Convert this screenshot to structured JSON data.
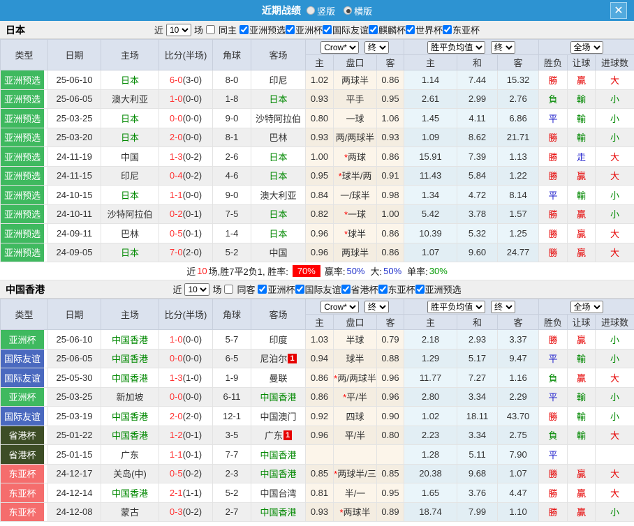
{
  "titlebar": {
    "title": "近期战绩",
    "vertical_label": "竖版",
    "horizontal_label": "横版",
    "close_glyph": "✕"
  },
  "columns": {
    "type": "类型",
    "date": "日期",
    "home": "主场",
    "score": "比分(半场)",
    "corner": "角球",
    "away": "客场",
    "h": "主",
    "hcp": "盘口",
    "a": "客",
    "avg_h": "主",
    "avg_d": "和",
    "avg_a": "客",
    "wdl": "胜负",
    "hcp_r": "让球",
    "goals": "进球数"
  },
  "sections": [
    {
      "team": "日本",
      "filter": {
        "near_label": "近",
        "near_value": "10",
        "games_label": "场",
        "same_label": "同主",
        "leagues": [
          "亚洲预选",
          "亚洲杯",
          "国际友谊",
          "麒麟杯",
          "世界杯",
          "东亚杯"
        ]
      },
      "controls": {
        "provider": "Crow*",
        "final1": "终",
        "avg": "胜平负均值",
        "final2": "终",
        "scope": "全场"
      },
      "rows": [
        {
          "type": "亚洲预选",
          "tc": "green",
          "date": "25-06-10",
          "home": "日本",
          "hg": true,
          "score": "6-0",
          "half": "(3-0)",
          "corner": "8-0",
          "away": "印尼",
          "ag": false,
          "ab": "",
          "oh": "1.02",
          "hcp": "两球半",
          "oa": "0.86",
          "ah": "1.14",
          "ad": "7.44",
          "aa": "15.32",
          "r1": "勝",
          "r2": "贏",
          "r3": "大"
        },
        {
          "type": "亚洲预选",
          "tc": "green",
          "date": "25-06-05",
          "home": "澳大利亚",
          "hg": false,
          "score": "1-0",
          "half": "(0-0)",
          "corner": "1-8",
          "away": "日本",
          "ag": true,
          "ab": "",
          "oh": "0.93",
          "hcp": "平手",
          "oa": "0.95",
          "ah": "2.61",
          "ad": "2.99",
          "aa": "2.76",
          "r1": "負",
          "r2": "輸",
          "r3": "小"
        },
        {
          "type": "亚洲预选",
          "tc": "green",
          "date": "25-03-25",
          "home": "日本",
          "hg": true,
          "score": "0-0",
          "half": "(0-0)",
          "corner": "9-0",
          "away": "沙特阿拉伯",
          "ag": false,
          "ab": "",
          "oh": "0.80",
          "hcp": "一球",
          "oa": "1.06",
          "ah": "1.45",
          "ad": "4.11",
          "aa": "6.86",
          "r1": "平",
          "r2": "輸",
          "r3": "小"
        },
        {
          "type": "亚洲预选",
          "tc": "green",
          "date": "25-03-20",
          "home": "日本",
          "hg": true,
          "score": "2-0",
          "half": "(0-0)",
          "corner": "8-1",
          "away": "巴林",
          "ag": false,
          "ab": "",
          "oh": "0.93",
          "hcp": "两/两球半",
          "oa": "0.93",
          "ah": "1.09",
          "ad": "8.62",
          "aa": "21.71",
          "r1": "勝",
          "r2": "輸",
          "r3": "小"
        },
        {
          "type": "亚洲预选",
          "tc": "green",
          "date": "24-11-19",
          "home": "中国",
          "hg": false,
          "score": "1-3",
          "half": "(0-2)",
          "corner": "2-6",
          "away": "日本",
          "ag": true,
          "ab": "",
          "oh": "1.00",
          "hcp": "*两球",
          "oa": "0.86",
          "ah": "15.91",
          "ad": "7.39",
          "aa": "1.13",
          "r1": "勝",
          "r2": "走",
          "r3": "大"
        },
        {
          "type": "亚洲预选",
          "tc": "green",
          "date": "24-11-15",
          "home": "印尼",
          "hg": false,
          "score": "0-4",
          "half": "(0-2)",
          "corner": "4-6",
          "away": "日本",
          "ag": true,
          "ab": "",
          "oh": "0.95",
          "hcp": "*球半/两",
          "oa": "0.91",
          "ah": "11.43",
          "ad": "5.84",
          "aa": "1.22",
          "r1": "勝",
          "r2": "贏",
          "r3": "大"
        },
        {
          "type": "亚洲预选",
          "tc": "green",
          "date": "24-10-15",
          "home": "日本",
          "hg": true,
          "score": "1-1",
          "half": "(0-0)",
          "corner": "9-0",
          "away": "澳大利亚",
          "ag": false,
          "ab": "",
          "oh": "0.84",
          "hcp": "一/球半",
          "oa": "0.98",
          "ah": "1.34",
          "ad": "4.72",
          "aa": "8.14",
          "r1": "平",
          "r2": "輸",
          "r3": "小"
        },
        {
          "type": "亚洲预选",
          "tc": "green",
          "date": "24-10-11",
          "home": "沙特阿拉伯",
          "hg": false,
          "score": "0-2",
          "half": "(0-1)",
          "corner": "7-5",
          "away": "日本",
          "ag": true,
          "ab": "",
          "oh": "0.82",
          "hcp": "*一球",
          "oa": "1.00",
          "ah": "5.42",
          "ad": "3.78",
          "aa": "1.57",
          "r1": "勝",
          "r2": "贏",
          "r3": "小"
        },
        {
          "type": "亚洲预选",
          "tc": "green",
          "date": "24-09-11",
          "home": "巴林",
          "hg": false,
          "score": "0-5",
          "half": "(0-1)",
          "corner": "1-4",
          "away": "日本",
          "ag": true,
          "ab": "",
          "oh": "0.96",
          "hcp": "*球半",
          "oa": "0.86",
          "ah": "10.39",
          "ad": "5.32",
          "aa": "1.25",
          "r1": "勝",
          "r2": "贏",
          "r3": "大"
        },
        {
          "type": "亚洲预选",
          "tc": "green",
          "date": "24-09-05",
          "home": "日本",
          "hg": true,
          "score": "7-0",
          "half": "(2-0)",
          "corner": "5-2",
          "away": "中国",
          "ag": false,
          "ab": "",
          "oh": "0.96",
          "hcp": "两球半",
          "oa": "0.86",
          "ah": "1.07",
          "ad": "9.60",
          "aa": "24.77",
          "r1": "勝",
          "r2": "贏",
          "r3": "大"
        }
      ],
      "summary": {
        "part1": "近",
        "count": "10",
        "part2": "场,胜7平2负1, 胜率:",
        "badge": "70%",
        "win_label": "赢率:",
        "win_value": "50%",
        "big_label": "大:",
        "big_value": "50%",
        "single_label": "单率:",
        "single_value": "30%"
      }
    },
    {
      "team": "中国香港",
      "filter": {
        "near_label": "近",
        "near_value": "10",
        "games_label": "场",
        "same_label": "同客",
        "leagues": [
          "亚洲杯",
          "国际友谊",
          "省港杯",
          "东亚杯",
          "亚洲预选"
        ]
      },
      "controls": {
        "provider": "Crow*",
        "final1": "终",
        "avg": "胜平负均值",
        "final2": "终",
        "scope": "全场"
      },
      "rows": [
        {
          "type": "亚洲杯",
          "tc": "green",
          "date": "25-06-10",
          "home": "中国香港",
          "hg": true,
          "score": "1-0",
          "half": "(0-0)",
          "corner": "5-7",
          "away": "印度",
          "ag": false,
          "ab": "",
          "oh": "1.03",
          "hcp": "半球",
          "oa": "0.79",
          "ah": "2.18",
          "ad": "2.93",
          "aa": "3.37",
          "r1": "勝",
          "r2": "贏",
          "r3": "小"
        },
        {
          "type": "国际友谊",
          "tc": "blue",
          "date": "25-06-05",
          "home": "中国香港",
          "hg": true,
          "score": "0-0",
          "half": "(0-0)",
          "corner": "6-5",
          "away": "尼泊尔",
          "ag": false,
          "ab": "1",
          "oh": "0.94",
          "hcp": "球半",
          "oa": "0.88",
          "ah": "1.29",
          "ad": "5.17",
          "aa": "9.47",
          "r1": "平",
          "r2": "輸",
          "r3": "小"
        },
        {
          "type": "国际友谊",
          "tc": "blue",
          "date": "25-05-30",
          "home": "中国香港",
          "hg": true,
          "score": "1-3",
          "half": "(1-0)",
          "corner": "1-9",
          "away": "曼联",
          "ag": false,
          "ab": "",
          "oh": "0.86",
          "hcp": "*两/两球半",
          "oa": "0.96",
          "ah": "11.77",
          "ad": "7.27",
          "aa": "1.16",
          "r1": "負",
          "r2": "贏",
          "r3": "大"
        },
        {
          "type": "亚洲杯",
          "tc": "green",
          "date": "25-03-25",
          "home": "新加坡",
          "hg": false,
          "score": "0-0",
          "half": "(0-0)",
          "corner": "6-11",
          "away": "中国香港",
          "ag": true,
          "ab": "",
          "oh": "0.86",
          "hcp": "*平/半",
          "oa": "0.96",
          "ah": "2.80",
          "ad": "3.34",
          "aa": "2.29",
          "r1": "平",
          "r2": "輸",
          "r3": "小"
        },
        {
          "type": "国际友谊",
          "tc": "blue",
          "date": "25-03-19",
          "home": "中国香港",
          "hg": true,
          "score": "2-0",
          "half": "(2-0)",
          "corner": "12-1",
          "away": "中国澳门",
          "ag": false,
          "ab": "",
          "oh": "0.92",
          "hcp": "四球",
          "oa": "0.90",
          "ah": "1.02",
          "ad": "18.11",
          "aa": "43.70",
          "r1": "勝",
          "r2": "輸",
          "r3": "小"
        },
        {
          "type": "省港杯",
          "tc": "olive",
          "date": "25-01-22",
          "home": "中国香港",
          "hg": true,
          "score": "1-2",
          "half": "(0-1)",
          "corner": "3-5",
          "away": "广东",
          "ag": false,
          "ab": "1",
          "oh": "0.96",
          "hcp": "平/半",
          "oa": "0.80",
          "ah": "2.23",
          "ad": "3.34",
          "aa": "2.75",
          "r1": "負",
          "r2": "輸",
          "r3": "大"
        },
        {
          "type": "省港杯",
          "tc": "olive",
          "date": "25-01-15",
          "home": "广东",
          "hg": false,
          "score": "1-1",
          "half": "(0-1)",
          "corner": "7-7",
          "away": "中国香港",
          "ag": true,
          "ab": "",
          "oh": "",
          "hcp": "",
          "oa": "",
          "ah": "1.28",
          "ad": "5.11",
          "aa": "7.90",
          "r1": "平",
          "r2": "",
          "r3": ""
        },
        {
          "type": "东亚杯",
          "tc": "salmon",
          "date": "24-12-17",
          "home": "关岛(中)",
          "hg": false,
          "score": "0-5",
          "half": "(0-2)",
          "corner": "2-3",
          "away": "中国香港",
          "ag": true,
          "ab": "",
          "oh": "0.85",
          "hcp": "*两球半/三",
          "oa": "0.85",
          "ah": "20.38",
          "ad": "9.68",
          "aa": "1.07",
          "r1": "勝",
          "r2": "贏",
          "r3": "大"
        },
        {
          "type": "东亚杯",
          "tc": "salmon",
          "date": "24-12-14",
          "home": "中国香港",
          "hg": true,
          "score": "2-1",
          "half": "(1-1)",
          "corner": "5-2",
          "away": "中国台湾",
          "ag": false,
          "ab": "",
          "oh": "0.81",
          "hcp": "半/一",
          "oa": "0.95",
          "ah": "1.65",
          "ad": "3.76",
          "aa": "4.47",
          "r1": "勝",
          "r2": "贏",
          "r3": "大"
        },
        {
          "type": "东亚杯",
          "tc": "salmon",
          "date": "24-12-08",
          "home": "蒙古",
          "hg": false,
          "score": "0-3",
          "half": "(0-2)",
          "corner": "2-7",
          "away": "中国香港",
          "ag": true,
          "ab": "",
          "oh": "0.93",
          "hcp": "*两球半",
          "oa": "0.89",
          "ah": "18.74",
          "ad": "7.99",
          "aa": "1.10",
          "r1": "勝",
          "r2": "贏",
          "r3": "小"
        }
      ]
    }
  ]
}
